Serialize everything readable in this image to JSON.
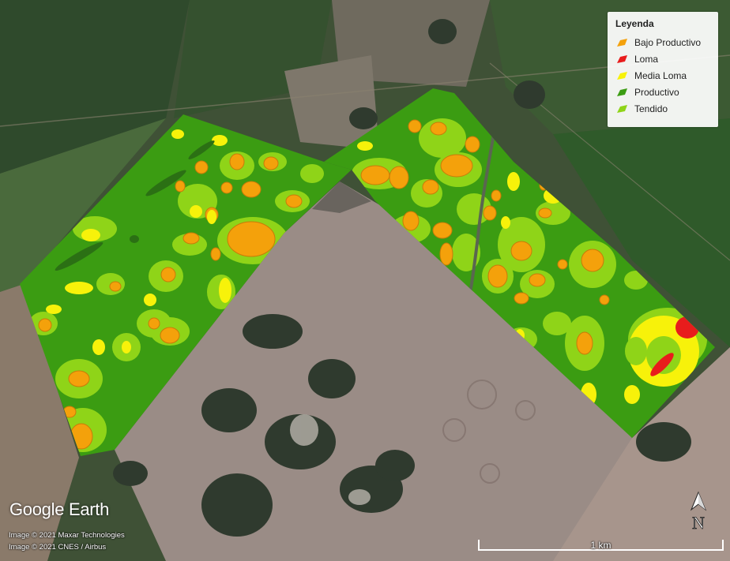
{
  "legend": {
    "title": "Leyenda",
    "items": [
      {
        "label": "Bajo Productivo",
        "color": "#f4a10b"
      },
      {
        "label": "Loma",
        "color": "#e81c1c"
      },
      {
        "label": "Media Loma",
        "color": "#f7f20a"
      },
      {
        "label": "Productivo",
        "color": "#3b9c12"
      },
      {
        "label": "Tendido",
        "color": "#8fd418"
      }
    ]
  },
  "branding": {
    "logo_text": "Google Earth",
    "credit_1": "Image © 2021 Maxar Technologies",
    "credit_2": "Image © 2021 CNES / Airbus"
  },
  "compass": {
    "label": "N",
    "icon": "north-arrow-icon"
  },
  "scale": {
    "label": "1 km"
  },
  "colors": {
    "imagery_dark": "#3d4a33",
    "field_bare": "#9a8c86",
    "lagoon": "#2f3a2e"
  }
}
